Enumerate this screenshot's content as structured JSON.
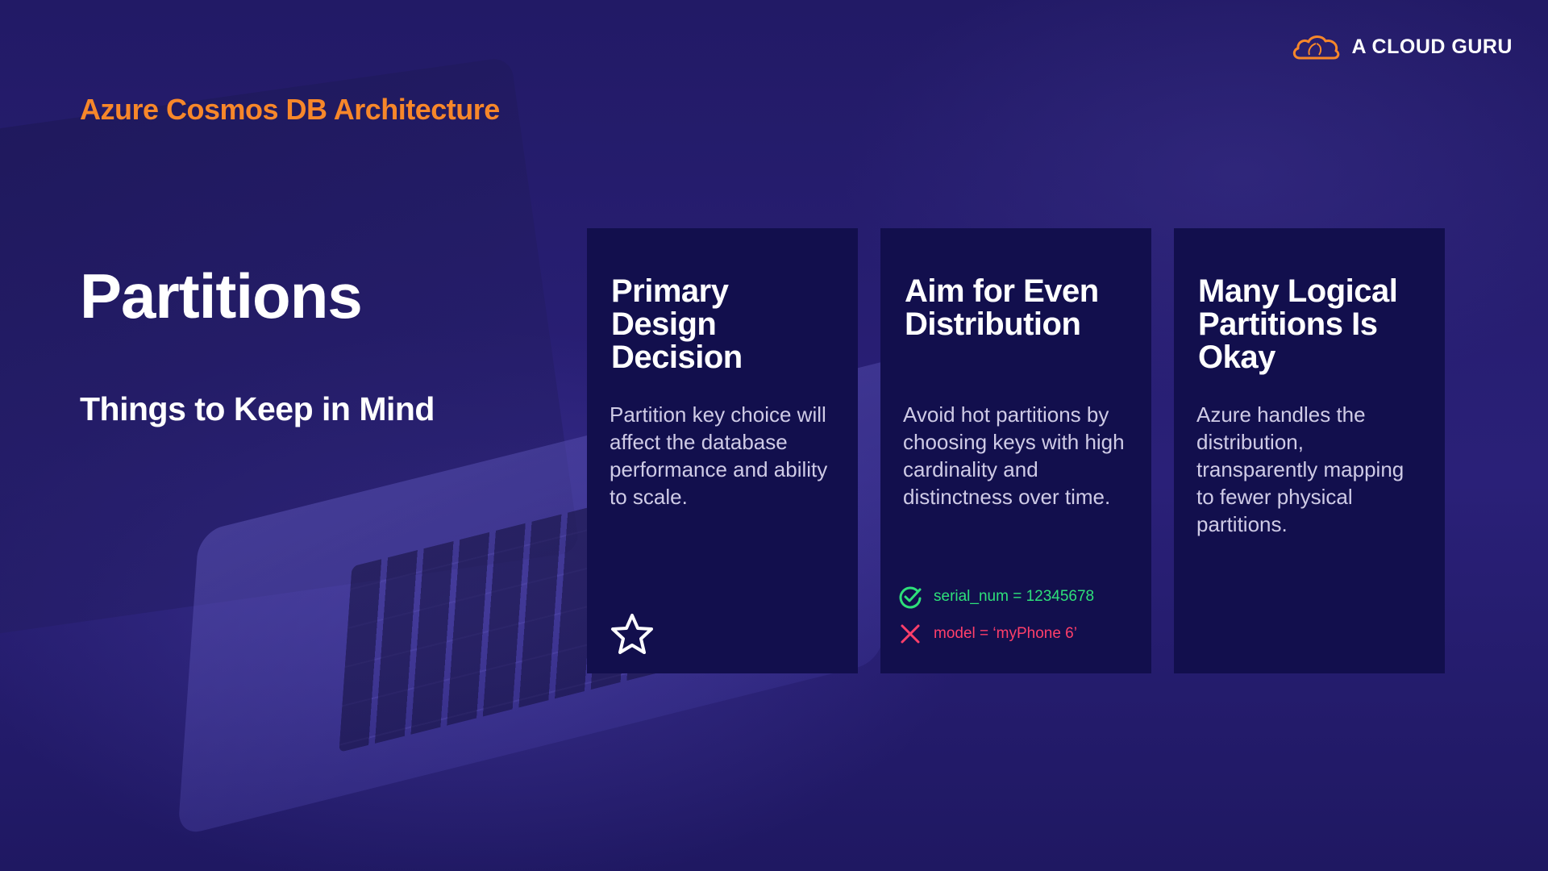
{
  "brand": {
    "logo_text": "A CLOUD GURU",
    "accent": "#f7872a"
  },
  "header": {
    "section_title": "Azure Cosmos DB Architecture"
  },
  "main": {
    "title": "Partitions",
    "subtitle": "Things to Keep in Mind"
  },
  "cards": [
    {
      "title": "Primary Design Decision",
      "body": "Partition key choice will affect the database performance and ability to scale.",
      "icon": "star-icon"
    },
    {
      "title": "Aim for Even Distribution",
      "body": "Avoid hot partitions by choosing keys with high cardinality and distinctness over time.",
      "examples": [
        {
          "text": "serial_num = 12345678",
          "status": "good",
          "icon": "check-circle-icon",
          "color": "#2ee07a"
        },
        {
          "text": "model = ‘myPhone 6’",
          "status": "bad",
          "icon": "x-icon",
          "color": "#ff3f6a"
        }
      ]
    },
    {
      "title": "Many Logical Partitions Is Okay",
      "body": "Azure handles the distribution, transparently mapping to fewer physical partitions."
    }
  ],
  "colors": {
    "card_bg": "#120f4d",
    "background": "#241c6b",
    "title_orange": "#f7872a"
  }
}
